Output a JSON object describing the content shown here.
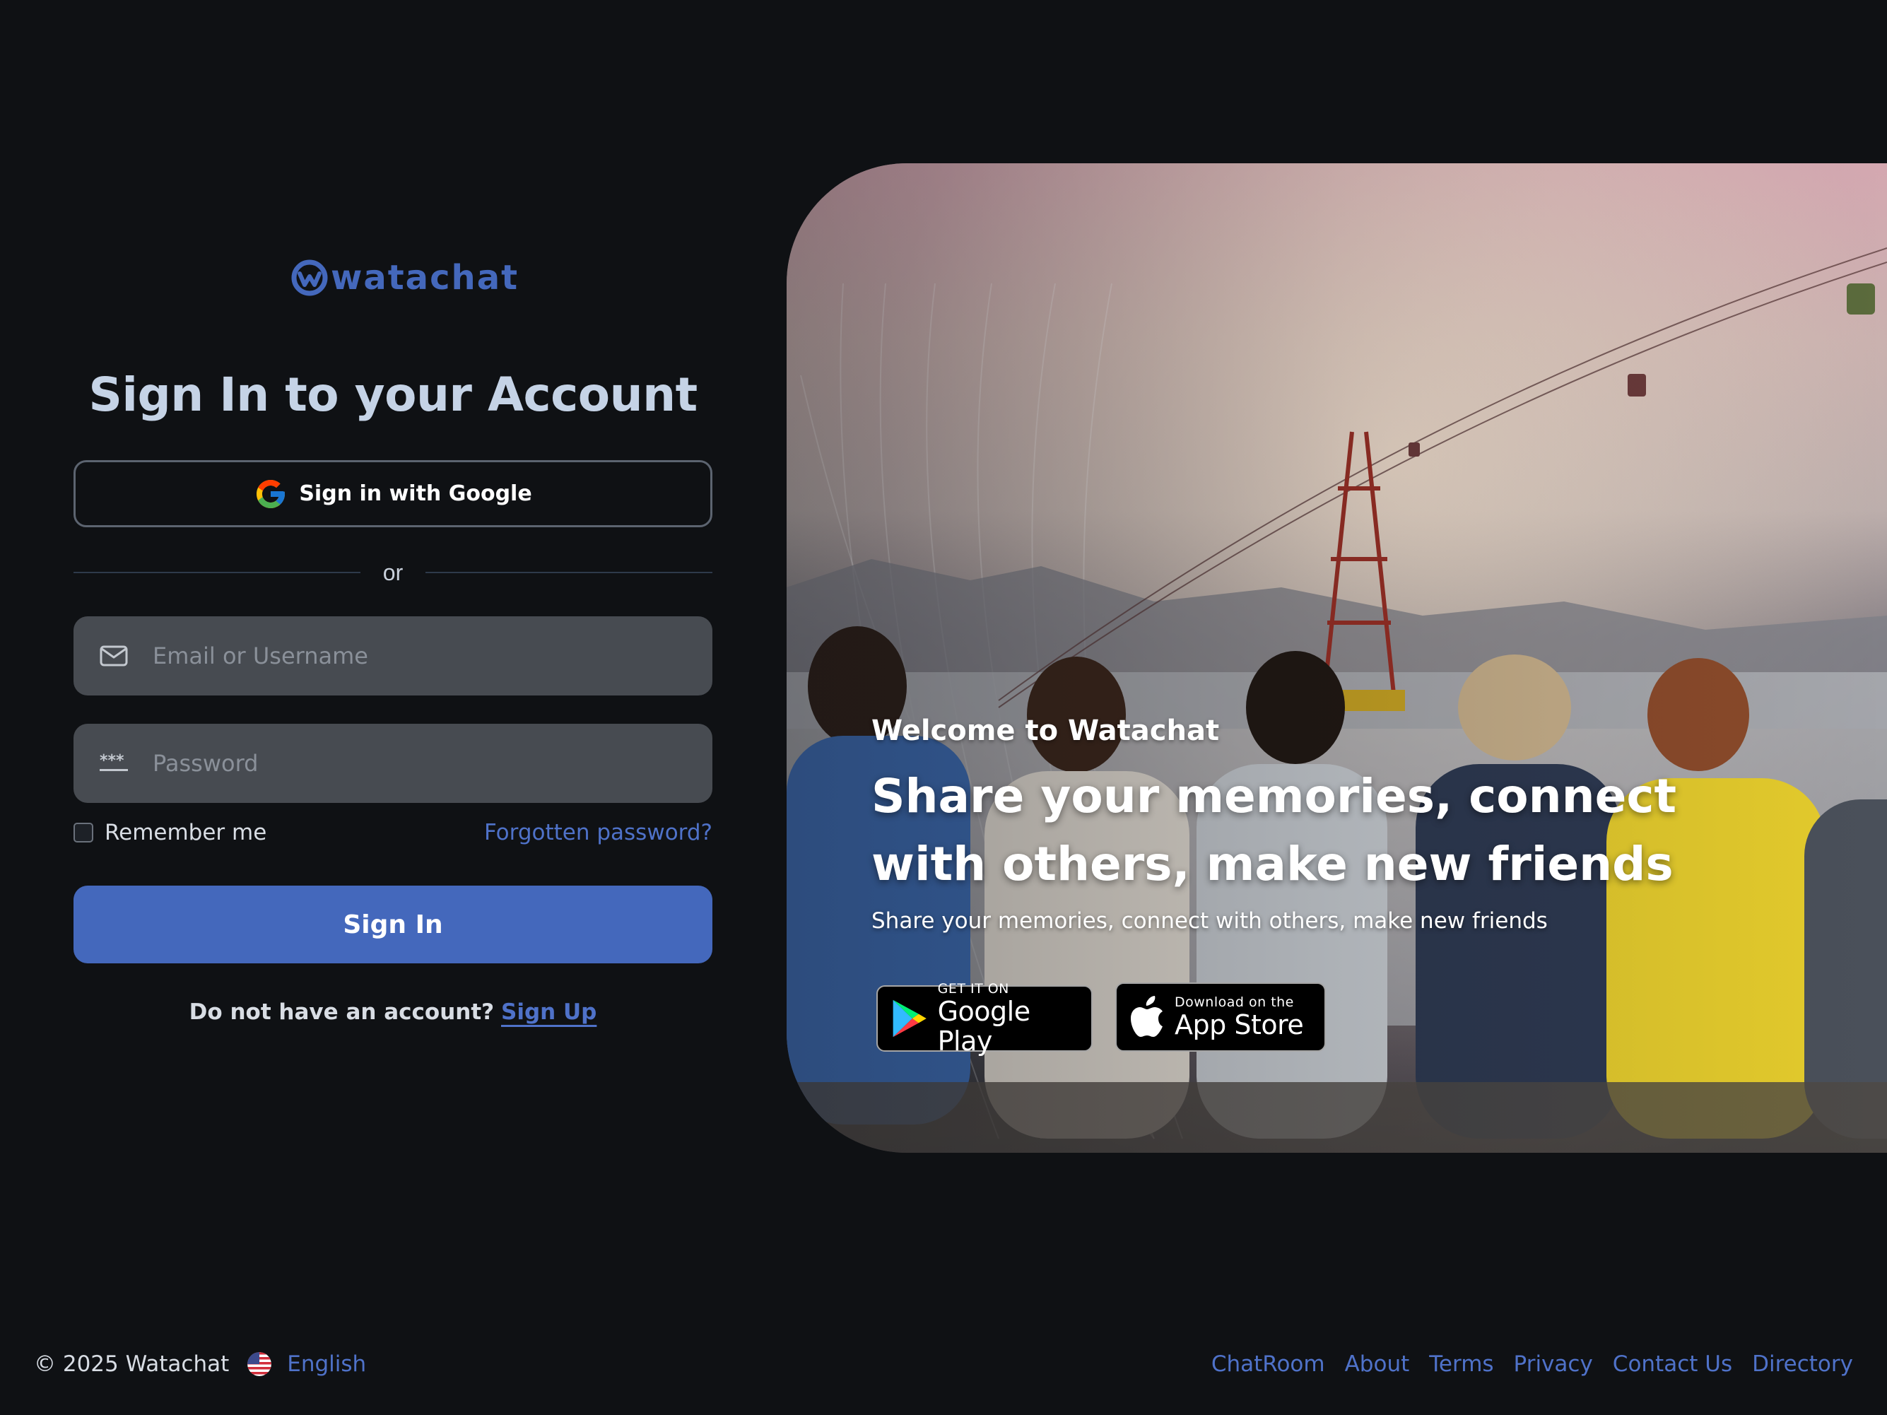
{
  "brand": {
    "name": "watachat",
    "accent": "#4468bc",
    "link_color": "#4f72c9"
  },
  "signin": {
    "title": "Sign In to your Account",
    "google_label": "Sign in with Google",
    "divider_text": "or",
    "email_placeholder": "Email or Username",
    "password_placeholder": "Password",
    "remember_label": "Remember me",
    "remember_checked": false,
    "forgot_label": "Forgotten password?",
    "submit_label": "Sign In",
    "no_account_text": "Do not have an account?",
    "signup_label": "Sign Up"
  },
  "hero": {
    "kicker": "Welcome to Watachat",
    "headline": "Share your memories, connect with others, make new friends",
    "subtext": "Share your memories, connect with others, make new friends",
    "google_play": {
      "small": "GET IT ON",
      "big": "Google Play"
    },
    "app_store": {
      "small": "Download on the",
      "big": "App Store"
    }
  },
  "footer": {
    "copyright": "© 2025 Watachat",
    "language": "English",
    "links": [
      "ChatRoom",
      "About",
      "Terms",
      "Privacy",
      "Contact Us",
      "Directory"
    ]
  },
  "icons": {
    "logo": "watachat-logo-icon",
    "google": "google-g-icon",
    "email": "envelope-icon",
    "password": "password-dots-icon",
    "flag": "us-flag-icon",
    "play": "google-play-icon",
    "apple": "apple-icon"
  }
}
